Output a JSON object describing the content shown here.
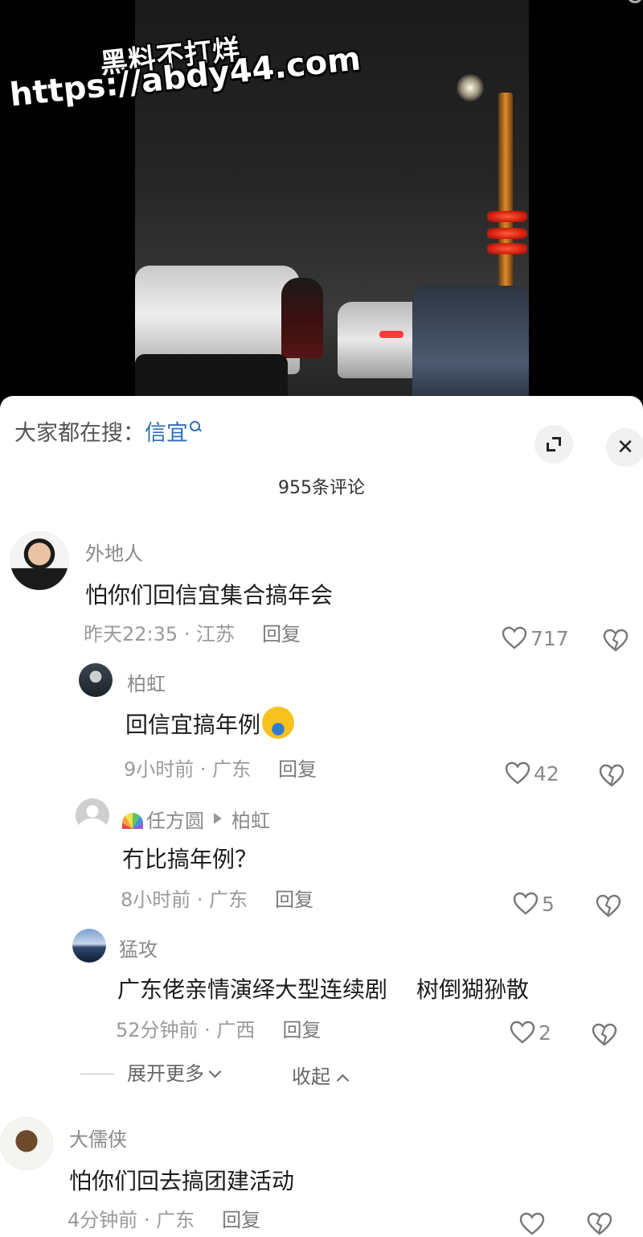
{
  "watermark": {
    "line1": "黑料不打烊",
    "line2": "https://abdy44.com"
  },
  "search": {
    "prefix": "大家都在搜：",
    "keyword": "信宜"
  },
  "buttons": {
    "close": "✕"
  },
  "comments_count": "955条评论",
  "comments": [
    {
      "name": "外地人",
      "text": "怕你们回信宜集合搞年会",
      "time": "昨天22:35 · 江苏",
      "reply": "回复",
      "likes": "717"
    },
    {
      "name": "柏虹",
      "text": "回信宜搞年例",
      "time": "9小时前 · 广东",
      "reply": "回复",
      "likes": "42"
    },
    {
      "name": "任方圆",
      "reply_to": "柏虹",
      "text": "冇比搞年例？",
      "time": "8小时前 · 广东",
      "reply": "回复",
      "likes": "5"
    },
    {
      "name": "猛攻",
      "text": "广东佬亲情演绎大型连续剧",
      "text_extra": "树倒猢狲散",
      "time": "52分钟前 · 广西",
      "reply": "回复",
      "likes": "2"
    },
    {
      "name": "大儒侠",
      "text": "怕你们回去搞团建活动",
      "time": "4分钟前 · 广东",
      "reply": "回复"
    }
  ],
  "thread_controls": {
    "expand": "展开更多",
    "collapse": "收起"
  },
  "icons": {
    "like": "heart-outline-icon",
    "dislike": "broken-heart-icon",
    "expand": "expand-icon",
    "close": "close-icon",
    "search": "search-icon"
  },
  "colors": {
    "keyword": "#2e6fb5",
    "meta": "#9a9a9a"
  }
}
